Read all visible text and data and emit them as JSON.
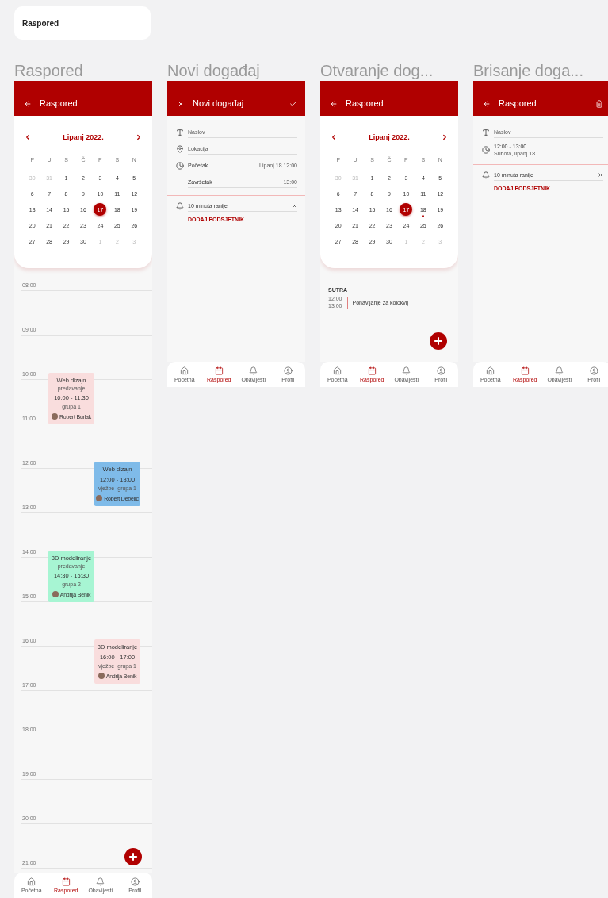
{
  "top_card": {
    "title": "Raspored"
  },
  "screens": [
    {
      "kind": "schedule",
      "caption": "Raspored",
      "header": {
        "kind": "view",
        "title": "Raspored"
      },
      "calendar": {
        "month": "Lipanj 2022.",
        "weekdays": [
          "P",
          "U",
          "S",
          "Č",
          "P",
          "S",
          "N"
        ],
        "weeks": [
          [
            {
              "label": "30",
              "muted": true,
              "selected": false,
              "dot": false
            },
            {
              "label": "31",
              "muted": true,
              "selected": false,
              "dot": false
            },
            {
              "label": "1",
              "muted": false,
              "selected": false,
              "dot": false
            },
            {
              "label": "2",
              "muted": false,
              "selected": false,
              "dot": false
            },
            {
              "label": "3",
              "muted": false,
              "selected": false,
              "dot": false
            },
            {
              "label": "4",
              "muted": false,
              "selected": false,
              "dot": false
            },
            {
              "label": "5",
              "muted": false,
              "selected": false,
              "dot": false
            }
          ],
          [
            {
              "label": "6",
              "muted": false,
              "selected": false,
              "dot": false
            },
            {
              "label": "7",
              "muted": false,
              "selected": false,
              "dot": false
            },
            {
              "label": "8",
              "muted": false,
              "selected": false,
              "dot": false
            },
            {
              "label": "9",
              "muted": false,
              "selected": false,
              "dot": false
            },
            {
              "label": "10",
              "muted": false,
              "selected": false,
              "dot": false
            },
            {
              "label": "11",
              "muted": false,
              "selected": false,
              "dot": false
            },
            {
              "label": "12",
              "muted": false,
              "selected": false,
              "dot": false
            }
          ],
          [
            {
              "label": "13",
              "muted": false,
              "selected": false,
              "dot": false
            },
            {
              "label": "14",
              "muted": false,
              "selected": false,
              "dot": false
            },
            {
              "label": "15",
              "muted": false,
              "selected": false,
              "dot": false
            },
            {
              "label": "16",
              "muted": false,
              "selected": false,
              "dot": false
            },
            {
              "label": "17",
              "muted": false,
              "selected": true,
              "dot": false
            },
            {
              "label": "18",
              "muted": false,
              "selected": false,
              "dot": false
            },
            {
              "label": "19",
              "muted": false,
              "selected": false,
              "dot": false
            }
          ],
          [
            {
              "label": "20",
              "muted": false,
              "selected": false,
              "dot": false
            },
            {
              "label": "21",
              "muted": false,
              "selected": false,
              "dot": false
            },
            {
              "label": "22",
              "muted": false,
              "selected": false,
              "dot": false
            },
            {
              "label": "23",
              "muted": false,
              "selected": false,
              "dot": false
            },
            {
              "label": "24",
              "muted": false,
              "selected": false,
              "dot": false
            },
            {
              "label": "25",
              "muted": false,
              "selected": false,
              "dot": false
            },
            {
              "label": "26",
              "muted": false,
              "selected": false,
              "dot": false
            }
          ],
          [
            {
              "label": "27",
              "muted": false,
              "selected": false,
              "dot": false
            },
            {
              "label": "28",
              "muted": false,
              "selected": false,
              "dot": false
            },
            {
              "label": "29",
              "muted": false,
              "selected": false,
              "dot": false
            },
            {
              "label": "30",
              "muted": false,
              "selected": false,
              "dot": false
            },
            {
              "label": "1",
              "muted": true,
              "selected": false,
              "dot": false
            },
            {
              "label": "2",
              "muted": true,
              "selected": false,
              "dot": false
            },
            {
              "label": "3",
              "muted": true,
              "selected": false,
              "dot": false
            }
          ]
        ]
      },
      "timeline": {
        "hours": [
          {
            "label": "08:00"
          },
          {
            "label": "09:00"
          },
          {
            "label": "10:00",
            "events": [
              {
                "kind": "lecture",
                "color": "#f9dddd",
                "title": "Web dizajn",
                "type": "predavanje",
                "time": "10:00 - 11:30",
                "group": "grupa 1",
                "person": "Robert Burlak"
              }
            ]
          },
          {
            "label": "11:00"
          },
          {
            "label": "12:00",
            "events": [
              {
                "kind": "exercise",
                "color": "#7fbbe9",
                "title": "Web dizajn",
                "type": "vježbe",
                "time": "12:00 - 13:00",
                "group": "grupa 1",
                "person": "Robert Debelić"
              }
            ]
          },
          {
            "label": "13:00"
          },
          {
            "label": "14:00",
            "events": [
              {
                "kind": "lecture",
                "color": "#a7f5d3",
                "title": "3D modeliranje",
                "type": "predavanje",
                "time": "14:30 - 15:30",
                "group": "grupa 2",
                "person": "Andrija Benik"
              }
            ]
          },
          {
            "label": "15:00"
          },
          {
            "label": "16:00",
            "events": [
              {
                "kind": "exercise",
                "color": "#f9dddd",
                "title": "3D modeliranje",
                "type": "vježbe",
                "time": "16:00 - 17:00",
                "group": "grupa 1",
                "person": "Andrija Benik"
              }
            ]
          },
          {
            "label": "17:00"
          },
          {
            "label": "18:00"
          },
          {
            "label": "19:00"
          },
          {
            "label": "20:00"
          },
          {
            "label": "21:00"
          }
        ]
      },
      "add_button": true,
      "nav": [
        {
          "label": "Početna",
          "selected": false
        },
        {
          "label": "Raspored",
          "selected": true
        },
        {
          "label": "Obavijesti",
          "selected": false
        },
        {
          "label": "Profil",
          "selected": false
        }
      ]
    },
    {
      "kind": "form",
      "caption": "Novi događaj",
      "header": {
        "kind": "create",
        "title": "Novi događaj"
      },
      "fields": [
        {
          "kind": "title",
          "placeholder": "Naslov"
        },
        {
          "kind": "location",
          "placeholder": "Lokacija"
        },
        {
          "kind": "start",
          "label": "Početak",
          "value": "Lipanj 18 12:00"
        },
        {
          "kind": "end",
          "label": "Završetak",
          "value": "13:00"
        }
      ],
      "reminders": [
        {
          "text": "10 minuta ranije"
        }
      ],
      "add_reminder": "DODAJ PODSJETNIK",
      "nav": [
        {
          "label": "Početna",
          "selected": false
        },
        {
          "label": "Raspored",
          "selected": true
        },
        {
          "label": "Obavijesti",
          "selected": false
        },
        {
          "label": "Profil",
          "selected": false
        }
      ]
    },
    {
      "kind": "agenda",
      "caption": "Otvaranje dog...",
      "header": {
        "kind": "view",
        "title": "Raspored"
      },
      "calendar": {
        "month": "Lipanj 2022.",
        "weekdays": [
          "P",
          "U",
          "S",
          "Č",
          "P",
          "S",
          "N"
        ],
        "weeks": [
          [
            {
              "label": "30",
              "muted": true,
              "selected": false,
              "dot": false
            },
            {
              "label": "31",
              "muted": true,
              "selected": false,
              "dot": false
            },
            {
              "label": "1",
              "muted": false,
              "selected": false,
              "dot": false
            },
            {
              "label": "2",
              "muted": false,
              "selected": false,
              "dot": false
            },
            {
              "label": "3",
              "muted": false,
              "selected": false,
              "dot": false
            },
            {
              "label": "4",
              "muted": false,
              "selected": false,
              "dot": false
            },
            {
              "label": "5",
              "muted": false,
              "selected": false,
              "dot": false
            }
          ],
          [
            {
              "label": "6",
              "muted": false,
              "selected": false,
              "dot": false
            },
            {
              "label": "7",
              "muted": false,
              "selected": false,
              "dot": false
            },
            {
              "label": "8",
              "muted": false,
              "selected": false,
              "dot": false
            },
            {
              "label": "9",
              "muted": false,
              "selected": false,
              "dot": false
            },
            {
              "label": "10",
              "muted": false,
              "selected": false,
              "dot": false
            },
            {
              "label": "11",
              "muted": false,
              "selected": false,
              "dot": false
            },
            {
              "label": "12",
              "muted": false,
              "selected": false,
              "dot": false
            }
          ],
          [
            {
              "label": "13",
              "muted": false,
              "selected": false,
              "dot": false
            },
            {
              "label": "14",
              "muted": false,
              "selected": false,
              "dot": false
            },
            {
              "label": "15",
              "muted": false,
              "selected": false,
              "dot": false
            },
            {
              "label": "16",
              "muted": false,
              "selected": false,
              "dot": false
            },
            {
              "label": "17",
              "muted": false,
              "selected": true,
              "dot": false
            },
            {
              "label": "18",
              "muted": false,
              "selected": false,
              "dot": true
            },
            {
              "label": "19",
              "muted": false,
              "selected": false,
              "dot": false
            }
          ],
          [
            {
              "label": "20",
              "muted": false,
              "selected": false,
              "dot": false
            },
            {
              "label": "21",
              "muted": false,
              "selected": false,
              "dot": false
            },
            {
              "label": "22",
              "muted": false,
              "selected": false,
              "dot": false
            },
            {
              "label": "23",
              "muted": false,
              "selected": false,
              "dot": false
            },
            {
              "label": "24",
              "muted": false,
              "selected": false,
              "dot": false
            },
            {
              "label": "25",
              "muted": false,
              "selected": false,
              "dot": false
            },
            {
              "label": "26",
              "muted": false,
              "selected": false,
              "dot": false
            }
          ],
          [
            {
              "label": "27",
              "muted": false,
              "selected": false,
              "dot": false
            },
            {
              "label": "28",
              "muted": false,
              "selected": false,
              "dot": false
            },
            {
              "label": "29",
              "muted": false,
              "selected": false,
              "dot": false
            },
            {
              "label": "30",
              "muted": false,
              "selected": false,
              "dot": false
            },
            {
              "label": "1",
              "muted": true,
              "selected": false,
              "dot": false
            },
            {
              "label": "2",
              "muted": true,
              "selected": false,
              "dot": false
            },
            {
              "label": "3",
              "muted": true,
              "selected": false,
              "dot": false
            }
          ]
        ]
      },
      "agenda": {
        "heading": "SUTRA",
        "items": [
          {
            "start": "12:00",
            "end": "13:00",
            "title": "Ponavljanje za kolokvij"
          }
        ]
      },
      "add_button": true,
      "nav": [
        {
          "label": "Početna",
          "selected": false
        },
        {
          "label": "Raspored",
          "selected": true
        },
        {
          "label": "Obavijesti",
          "selected": false
        },
        {
          "label": "Profil",
          "selected": false
        }
      ]
    },
    {
      "kind": "form",
      "caption": "Brisanje doga...",
      "header": {
        "kind": "edit",
        "title": "Raspored"
      },
      "fields": [
        {
          "kind": "title",
          "placeholder": "Naslov"
        },
        {
          "kind": "time_range",
          "label": "12:00 - 13:00",
          "sublabel": "Subota, lipanj 18"
        }
      ],
      "reminders": [
        {
          "text": "10 minuta ranije"
        }
      ],
      "add_reminder": "DODAJ PODSJETNIK",
      "nav": [
        {
          "label": "Početna",
          "selected": false
        },
        {
          "label": "Raspored",
          "selected": true
        },
        {
          "label": "Obavijesti",
          "selected": false
        },
        {
          "label": "Profil",
          "selected": false
        }
      ]
    }
  ]
}
